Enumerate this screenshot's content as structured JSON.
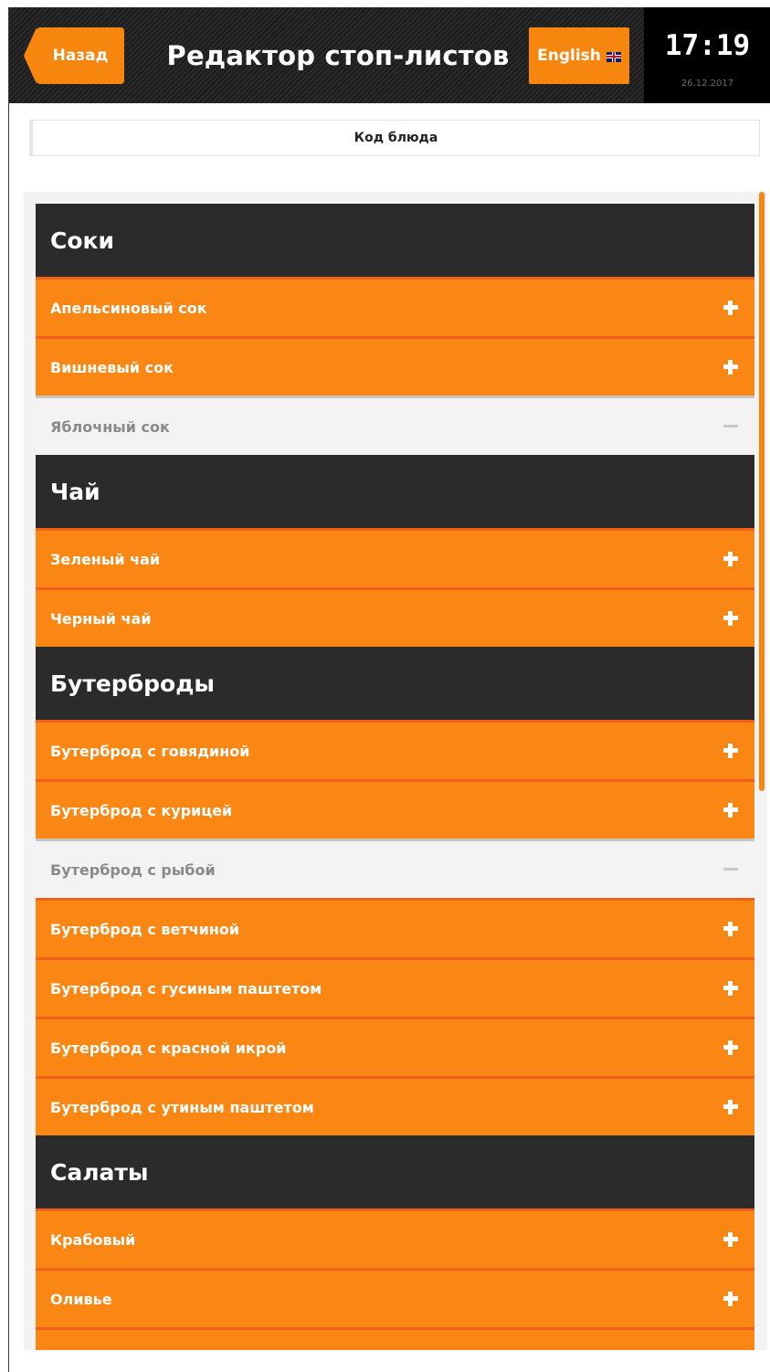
{
  "header": {
    "back_label": "Назад",
    "title": "Редактор стоп-листов",
    "language_label": "English",
    "language_icon": "uk-flag-icon",
    "time": "17:19",
    "date": "26.12.2017"
  },
  "code_bar": {
    "label": "Код блюда"
  },
  "colors": {
    "accent": "#f7860f",
    "item_background": "#fa8714",
    "item_divider": "#f25f1b",
    "category_background": "#2b2b2b",
    "header_background": "#222222",
    "stopped_item_text": "#8a8a8a"
  },
  "categories": [
    {
      "name": "Соки",
      "items": [
        {
          "name": "Апельсиновый сок",
          "action_icon": "plus-icon",
          "stopped": false
        },
        {
          "name": "Вишневый сок",
          "action_icon": "plus-icon",
          "stopped": false
        },
        {
          "name": "Яблочный сок",
          "action_icon": "minus-icon",
          "stopped": true
        }
      ]
    },
    {
      "name": "Чай",
      "items": [
        {
          "name": "Зеленый чай",
          "action_icon": "plus-icon",
          "stopped": false
        },
        {
          "name": "Черный чай",
          "action_icon": "plus-icon",
          "stopped": false
        }
      ]
    },
    {
      "name": "Бутерброды",
      "items": [
        {
          "name": "Бутерброд с говядиной",
          "action_icon": "plus-icon",
          "stopped": false
        },
        {
          "name": "Бутерброд с курицей",
          "action_icon": "plus-icon",
          "stopped": false
        },
        {
          "name": "Бутерброд с рыбой",
          "action_icon": "minus-icon",
          "stopped": true
        },
        {
          "name": "Бутерброд с ветчиной",
          "action_icon": "plus-icon",
          "stopped": false
        },
        {
          "name": "Бутерброд с гусиным паштетом",
          "action_icon": "plus-icon",
          "stopped": false
        },
        {
          "name": "Бутерброд с красной икрой",
          "action_icon": "plus-icon",
          "stopped": false
        },
        {
          "name": "Бутерброд с утиным паштетом",
          "action_icon": "plus-icon",
          "stopped": false
        }
      ]
    },
    {
      "name": "Салаты",
      "items": [
        {
          "name": "Крабовый",
          "action_icon": "plus-icon",
          "stopped": false
        },
        {
          "name": "Оливье",
          "action_icon": "plus-icon",
          "stopped": false
        },
        {
          "name": "",
          "action_icon": "plus-icon",
          "stopped": false
        }
      ]
    }
  ]
}
